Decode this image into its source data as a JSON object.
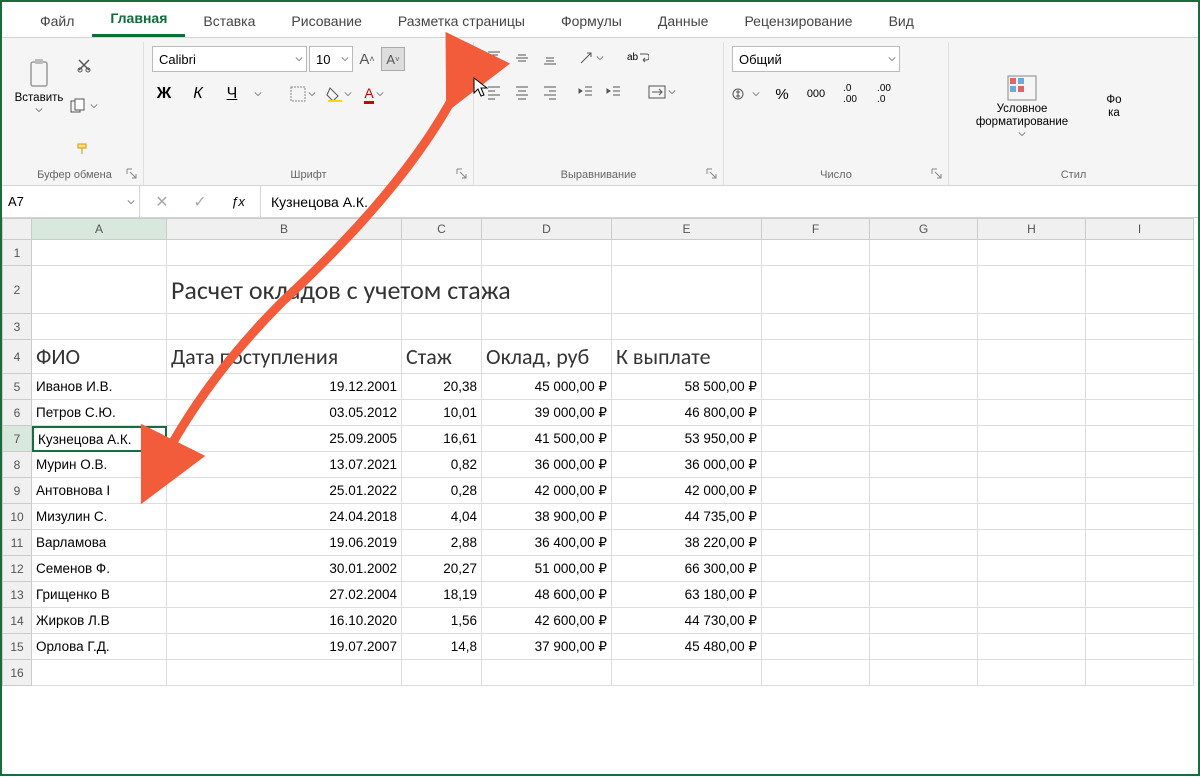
{
  "tabs": {
    "file": "Файл",
    "home": "Главная",
    "insert": "Вставка",
    "draw": "Рисование",
    "layout": "Разметка страницы",
    "formulas": "Формулы",
    "data": "Данные",
    "review": "Рецензирование",
    "view": "Вид"
  },
  "ribbon": {
    "clipboard": {
      "label": "Буфер обмена",
      "paste": "Вставить"
    },
    "font": {
      "label": "Шрифт",
      "name": "Calibri",
      "size": "10",
      "bold": "Ж",
      "italic": "К",
      "underline": "Ч"
    },
    "alignment": {
      "label": "Выравнивание",
      "wrap": "ab"
    },
    "number": {
      "label": "Число",
      "format": "Общий"
    },
    "styles": {
      "label": "Стил",
      "condfmt": "Условное форматирование",
      "fmttable_partial": "Фо\nка"
    }
  },
  "namebox": "A7",
  "formulabar": "Кузнецова А.К.",
  "columns": [
    "A",
    "B",
    "C",
    "D",
    "E",
    "F",
    "G",
    "H",
    "I"
  ],
  "sheet_title": "Расчет окладов с учетом стажа",
  "headers": {
    "A": "ФИО",
    "B": "Дата поступления",
    "C": "Стаж",
    "D": "Оклад, руб",
    "E": "К выплате"
  },
  "rows": [
    {
      "n": 5,
      "A": "Иванов И.В.",
      "B": "19.12.2001",
      "C": "20,38",
      "D": "45 000,00 ₽",
      "E": "58 500,00 ₽"
    },
    {
      "n": 6,
      "A": "Петров С.Ю.",
      "B": "03.05.2012",
      "C": "10,01",
      "D": "39 000,00 ₽",
      "E": "46 800,00 ₽"
    },
    {
      "n": 7,
      "A": "Кузнецова А.К.",
      "B": "25.09.2005",
      "C": "16,61",
      "D": "41 500,00 ₽",
      "E": "53 950,00 ₽"
    },
    {
      "n": 8,
      "A": "Мурин О.В.",
      "B": "13.07.2021",
      "C": "0,82",
      "D": "36 000,00 ₽",
      "E": "36 000,00 ₽"
    },
    {
      "n": 9,
      "A": "Антовнова I",
      "B": "25.01.2022",
      "C": "0,28",
      "D": "42 000,00 ₽",
      "E": "42 000,00 ₽"
    },
    {
      "n": 10,
      "A": "Мизулин С.",
      "B": "24.04.2018",
      "C": "4,04",
      "D": "38 900,00 ₽",
      "E": "44 735,00 ₽"
    },
    {
      "n": 11,
      "A": "Варламова",
      "B": "19.06.2019",
      "C": "2,88",
      "D": "36 400,00 ₽",
      "E": "38 220,00 ₽"
    },
    {
      "n": 12,
      "A": "Семенов Ф.",
      "B": "30.01.2002",
      "C": "20,27",
      "D": "51 000,00 ₽",
      "E": "66 300,00 ₽"
    },
    {
      "n": 13,
      "A": "Грищенко В",
      "B": "27.02.2004",
      "C": "18,19",
      "D": "48 600,00 ₽",
      "E": "63 180,00 ₽"
    },
    {
      "n": 14,
      "A": "Жирков Л.В",
      "B": "16.10.2020",
      "C": "1,56",
      "D": "42 600,00 ₽",
      "E": "44 730,00 ₽"
    },
    {
      "n": 15,
      "A": "Орлова Г.Д.",
      "B": "19.07.2007",
      "C": "14,8",
      "D": "37 900,00 ₽",
      "E": "45 480,00 ₽"
    }
  ],
  "selected": {
    "row": 7,
    "col": "A"
  },
  "colors": {
    "accent": "#0f6b3a",
    "arrow": "#f25c3b"
  }
}
